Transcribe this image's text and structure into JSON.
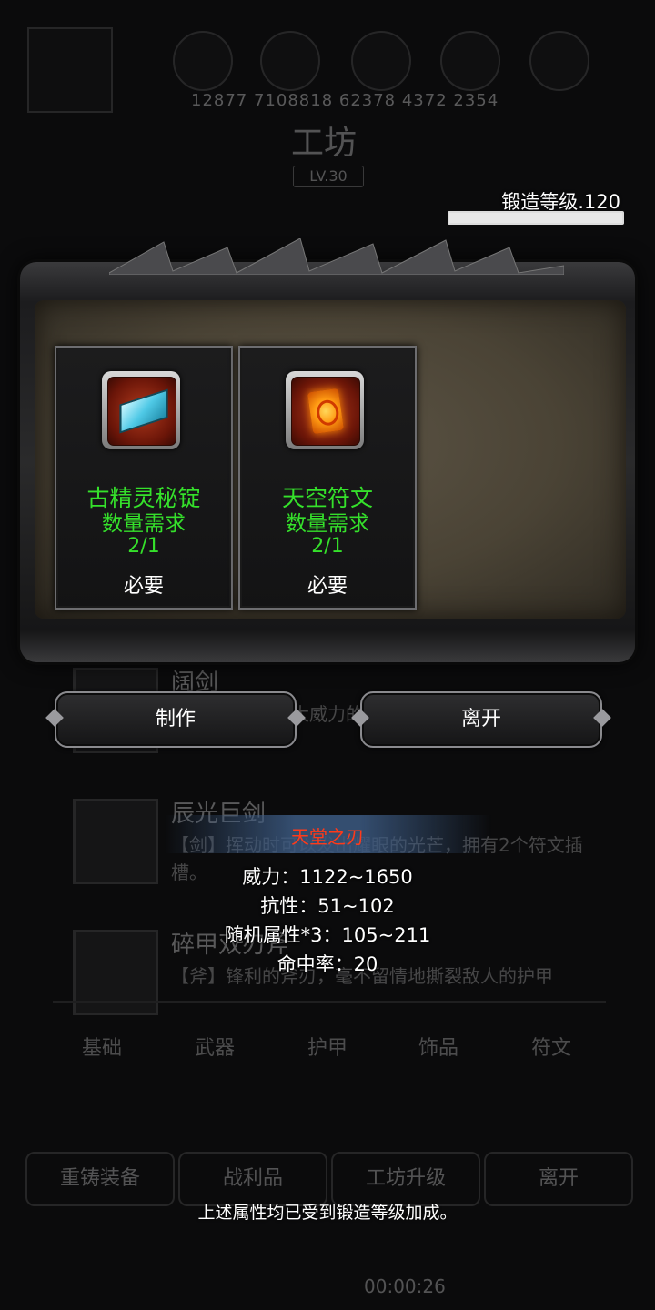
{
  "background": {
    "stats_text": "12877  7108818  62378  4372  2354",
    "title": "工坊",
    "level": "LV.30",
    "items": [
      {
        "name": "阔剑",
        "desc": "大威力的"
      },
      {
        "name": "辰光巨剑",
        "desc": "【剑】挥动时可以发出耀眼的光芒，拥有2个符文插槽。"
      },
      {
        "name": "碎甲双刃斧",
        "desc": "【斧】锋利的斧刃，毫不留情地撕裂敌人的护甲"
      }
    ],
    "tabs": [
      "基础",
      "武器",
      "护甲",
      "饰品",
      "符文"
    ],
    "bottom_buttons": [
      "重铸装备",
      "战利品",
      "工坊升级",
      "离开"
    ],
    "timer": "00:00:26"
  },
  "forge": {
    "label": "锻造等级.120",
    "progress": 1.0
  },
  "materials": [
    {
      "name": "古精灵秘锭",
      "qty_label": "数量需求",
      "qty": "2/1",
      "requirement": "必要",
      "icon": "mithril-ingot-icon"
    },
    {
      "name": "天空符文",
      "qty_label": "数量需求",
      "qty": "2/1",
      "requirement": "必要",
      "icon": "sky-rune-icon"
    }
  ],
  "actions": {
    "craft": "制作",
    "leave": "离开"
  },
  "tooltip": {
    "title": "天堂之刃",
    "lines": [
      "威力：1122~1650",
      "抗性：51~102",
      "随机属性*3：105~211",
      "命中率：20"
    ]
  },
  "footer_note": "上述属性均已受到锻造等级加成。",
  "colors": {
    "green_text": "#35e12b",
    "red_title": "#ff3a1a"
  }
}
